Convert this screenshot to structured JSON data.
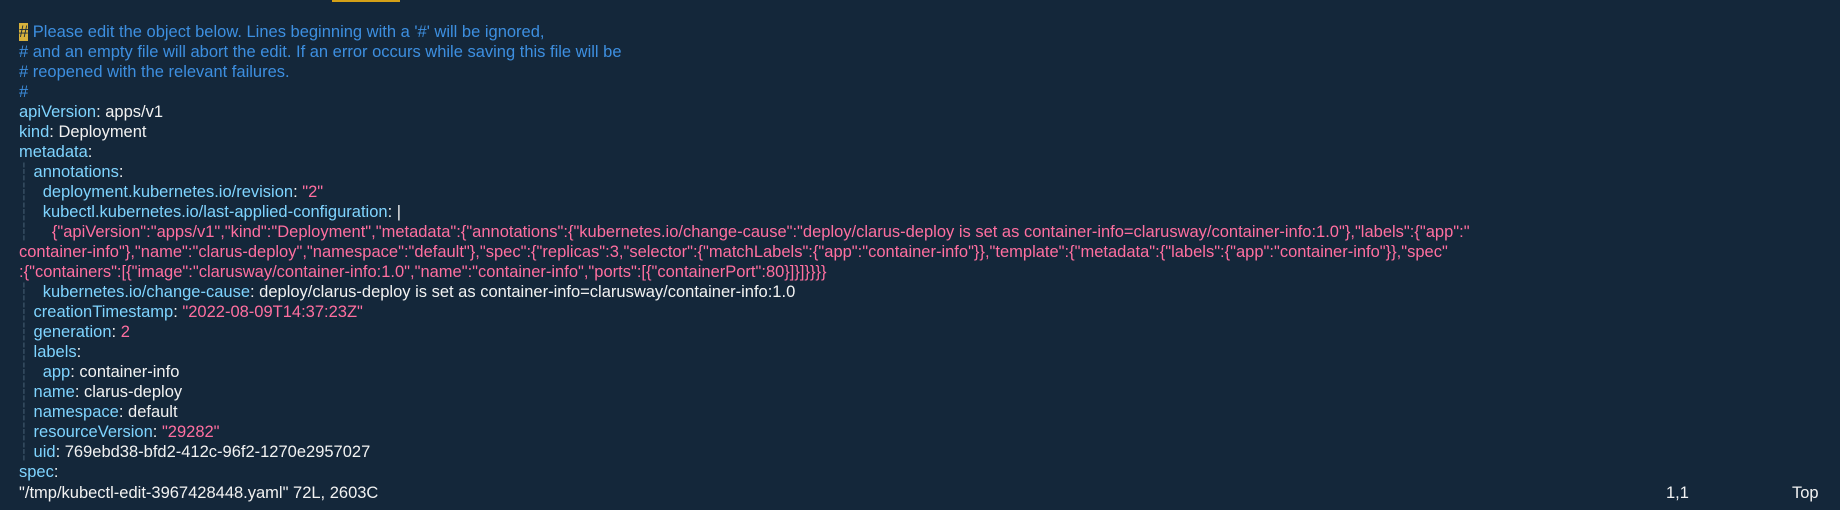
{
  "comments": {
    "c1_cursor": "#",
    "c1_rest": " Please edit the object below. Lines beginning with a '#' will be ignored,",
    "c2": "# and an empty file will abort the edit. If an error occurs while saving this file will be",
    "c3": "# reopened with the relevant failures.",
    "c4": "#"
  },
  "yaml": {
    "apiVersion_key": "apiVersion",
    "apiVersion_val": "apps/v1",
    "kind_key": "kind",
    "kind_val": "Deployment",
    "metadata_key": "metadata",
    "annotations_key": "annotations",
    "revision_key": "deployment.kubernetes.io/revision",
    "revision_val": "\"2\"",
    "lastapplied_key": "kubectl.kubernetes.io/last-applied-configuration",
    "lastapplied_val": "|",
    "json_line1": "{\"apiVersion\":\"apps/v1\",\"kind\":\"Deployment\",\"metadata\":{\"annotations\":{\"kubernetes.io/change-cause\":\"deploy/clarus-deploy is set as container-info=clarusway/container-info:1.0\"},\"labels\":{\"app\":\"",
    "json_line2": "container-info\"},\"name\":\"clarus-deploy\",\"namespace\":\"default\"},\"spec\":{\"replicas\":3,\"selector\":{\"matchLabels\":{\"app\":\"container-info\"}},\"template\":{\"metadata\":{\"labels\":{\"app\":\"container-info\"}},\"spec\"",
    "json_line3": ":{\"containers\":[{\"image\":\"clarusway/container-info:1.0\",\"name\":\"container-info\",\"ports\":[{\"containerPort\":80}]}]}}}}",
    "changecause_key": "kubernetes.io/change-cause",
    "changecause_val": "deploy/clarus-deploy is set as container-info=clarusway/container-info:1.0",
    "creation_key": "creationTimestamp",
    "creation_val": "\"2022-08-09T14:37:23Z\"",
    "generation_key": "generation",
    "generation_val": "2",
    "labels_key": "labels",
    "app_key": "app",
    "app_val": "container-info",
    "name_key": "name",
    "name_val": "clarus-deploy",
    "namespace_key": "namespace",
    "namespace_val": "default",
    "rv_key": "resourceVersion",
    "rv_val": "\"29282\"",
    "uid_key": "uid",
    "uid_val": "769ebd38-bfd2-412c-96f2-1270e2957027",
    "spec_key": "spec"
  },
  "status": {
    "file": "\"/tmp/kubectl-edit-3967428448.yaml\" 72L, 2603C",
    "position": "1,1",
    "scroll": "Top"
  },
  "colors": {
    "background": "#14273a",
    "comment": "#3d8fe0",
    "key": "#7fd4ff",
    "string": "#ff6fa0",
    "cursor": "#d7b13c"
  }
}
